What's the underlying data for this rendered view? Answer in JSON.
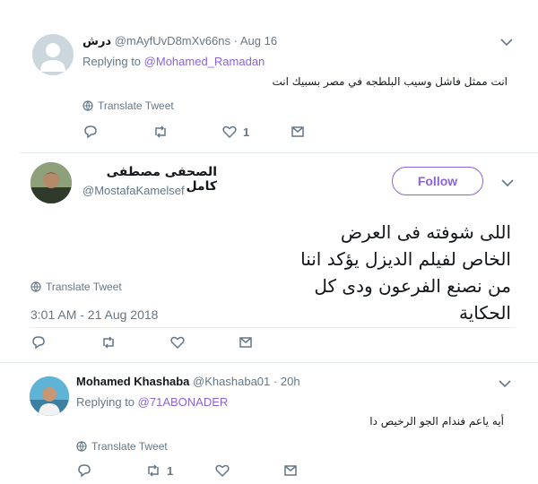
{
  "accent_color": "#8b63d8",
  "tweets": [
    {
      "display_name": "درش",
      "handle": "@mAyfUvD8mXv66ns",
      "dot": "·",
      "time": "Aug 16",
      "replying_prefix": "Replying to",
      "replying_to": "@Mohamed_Ramadan",
      "text": "انت ممثل فاشل وسيب البلطجه في مصر بسبيك انت",
      "translate": "Translate Tweet",
      "actions": {
        "reply": "",
        "retweet": "",
        "like": "1",
        "dm": ""
      },
      "avatar": "default-avatar"
    },
    {
      "display_name": "الصحفى مصطفى كامل",
      "handle": "@MostafaKamelsef",
      "follow_label": "Follow",
      "text": "اللى شوفته فى العرض الخاص لفيلم الديزل يؤكد اننا من نصنع الفرعون ودى كل الحكاية",
      "translate": "Translate Tweet",
      "timestamp": "3:01 AM - 21 Aug 2018",
      "actions": {
        "reply": "",
        "retweet": "",
        "like": "",
        "dm": ""
      },
      "avatar": "photo-avatar"
    },
    {
      "display_name": "Mohamed Khashaba",
      "handle": "@Khashaba01",
      "dot": "·",
      "time": "20h",
      "replying_prefix": "Replying to",
      "replying_to": "@71ABONADER",
      "text": "أيه ياعم فندام الجو الرخيص دا",
      "translate": "Translate Tweet",
      "actions": {
        "reply": "",
        "retweet": "1",
        "like": "",
        "dm": ""
      },
      "avatar": "photo-avatar"
    }
  ]
}
